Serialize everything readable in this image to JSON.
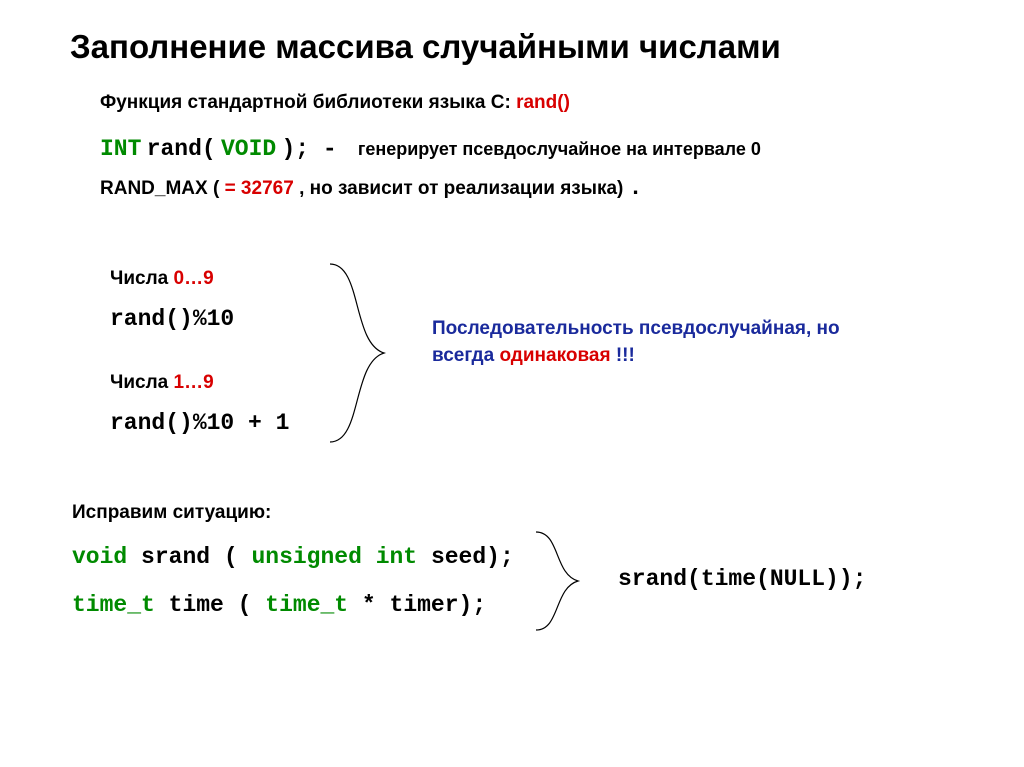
{
  "title": "Заполнение массива случайными числами",
  "intro": {
    "prefix": "Функция стандартной библиотеки языка С:   ",
    "func": "rand()"
  },
  "rand_sig": {
    "int": "INT",
    "sp1": " ",
    "name": "rand(",
    "void": "VOID",
    "close": "); -",
    "desc": "генерирует псевдослучайное на интервале 0"
  },
  "rand_max": {
    "pre": "RAND_MAX (",
    "red": "= 32767",
    "post": ", но зависит от реализации языка)"
  },
  "ranges": {
    "a": {
      "pre": "Числа ",
      "red": "0…9",
      "code": "rand()%10"
    },
    "b": {
      "pre": "Числа ",
      "red": "1…9",
      "code": "rand()%10 + 1"
    }
  },
  "seq": {
    "part1": "Последовательность псевдослучайная, но",
    "part2a": "всегда ",
    "red": "одинаковая",
    "part2b": " !!!"
  },
  "fix": {
    "label": "Исправим ситуацию:",
    "srand": {
      "kw1": "void",
      "name": "srand (",
      "kw2": "unsigned",
      "kw3": "int",
      "tail": "seed);"
    },
    "time": {
      "kw1": "time_t",
      "name": "time (",
      "kw2": "time_t",
      "tail": "* timer);"
    },
    "example": "srand(time(NULL));"
  }
}
